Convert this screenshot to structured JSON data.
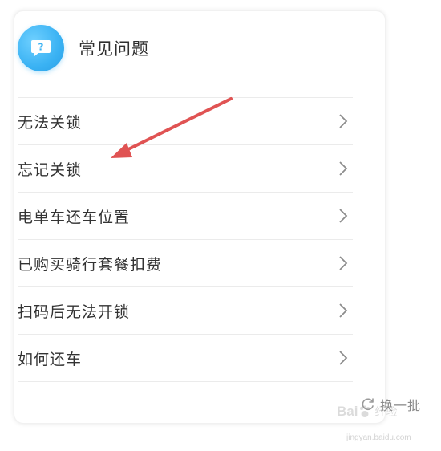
{
  "faq": {
    "title": "常见问题",
    "icon": "question-chat-icon",
    "items": [
      {
        "label": "无法关锁"
      },
      {
        "label": "忘记关锁"
      },
      {
        "label": "电单车还车位置"
      },
      {
        "label": "已购买骑行套餐扣费"
      },
      {
        "label": "扫码后无法开锁"
      },
      {
        "label": "如何还车"
      }
    ],
    "refresh_label": "换一批"
  },
  "watermark": {
    "brand": "Bai",
    "jingyan": "经验",
    "url": "jingyan.baidu.com"
  },
  "colors": {
    "accent_blue": "#3ab2f3",
    "annotation_arrow": "#e05353",
    "text_primary": "#333333",
    "text_secondary": "#8a8a8a"
  }
}
